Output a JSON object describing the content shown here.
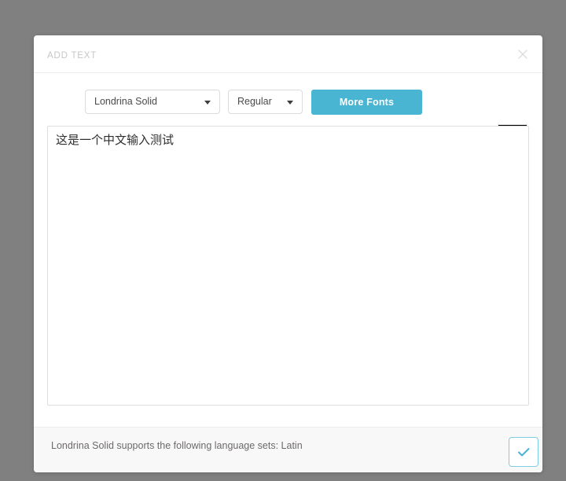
{
  "overlay": {
    "background_color": "#808080"
  },
  "dialog": {
    "title": "ADD TEXT",
    "close_icon": "close-icon",
    "accent_color": "#4ab5d3",
    "toolbar": {
      "font_select": {
        "value": "Londrina Solid",
        "caret_icon": "chevron-down-icon"
      },
      "style_select": {
        "value": "Regular",
        "caret_icon": "chevron-down-icon"
      },
      "more_fonts_label": "More Fonts",
      "alignment": {
        "left": {
          "icon": "align-left-icon",
          "active": true
        },
        "center": {
          "icon": "align-center-icon",
          "active": false
        },
        "right": {
          "icon": "align-right-icon",
          "active": false
        }
      },
      "color_swatch": {
        "icon": "color-swatch-icon",
        "value": "#000000"
      }
    },
    "editor": {
      "value": "这是一个中文输入测试",
      "placeholder": ""
    },
    "footer": {
      "note": "Londrina Solid supports the following language sets: Latin",
      "confirm_icon": "check-icon"
    }
  }
}
